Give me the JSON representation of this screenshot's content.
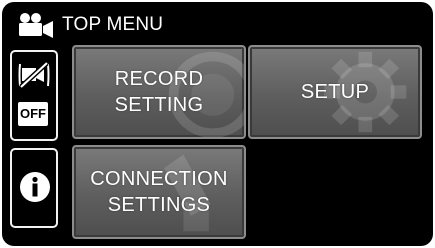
{
  "header": {
    "title": "TOP MENU",
    "icon": "movie-camera-icon"
  },
  "side": {
    "stabilizer_icon": "stabilizer-off-icon",
    "off_badge": "OFF",
    "info_icon": "info-icon"
  },
  "menu": {
    "record_line1": "RECORD",
    "record_line2": "SETTING",
    "setup": "SETUP",
    "connection_line1": "CONNECTION",
    "connection_line2": "SETTINGS"
  },
  "colors": {
    "background": "#000000",
    "button_face": "#6a6a6a",
    "button_border": "#8c8c8c",
    "text": "#ffffff"
  }
}
